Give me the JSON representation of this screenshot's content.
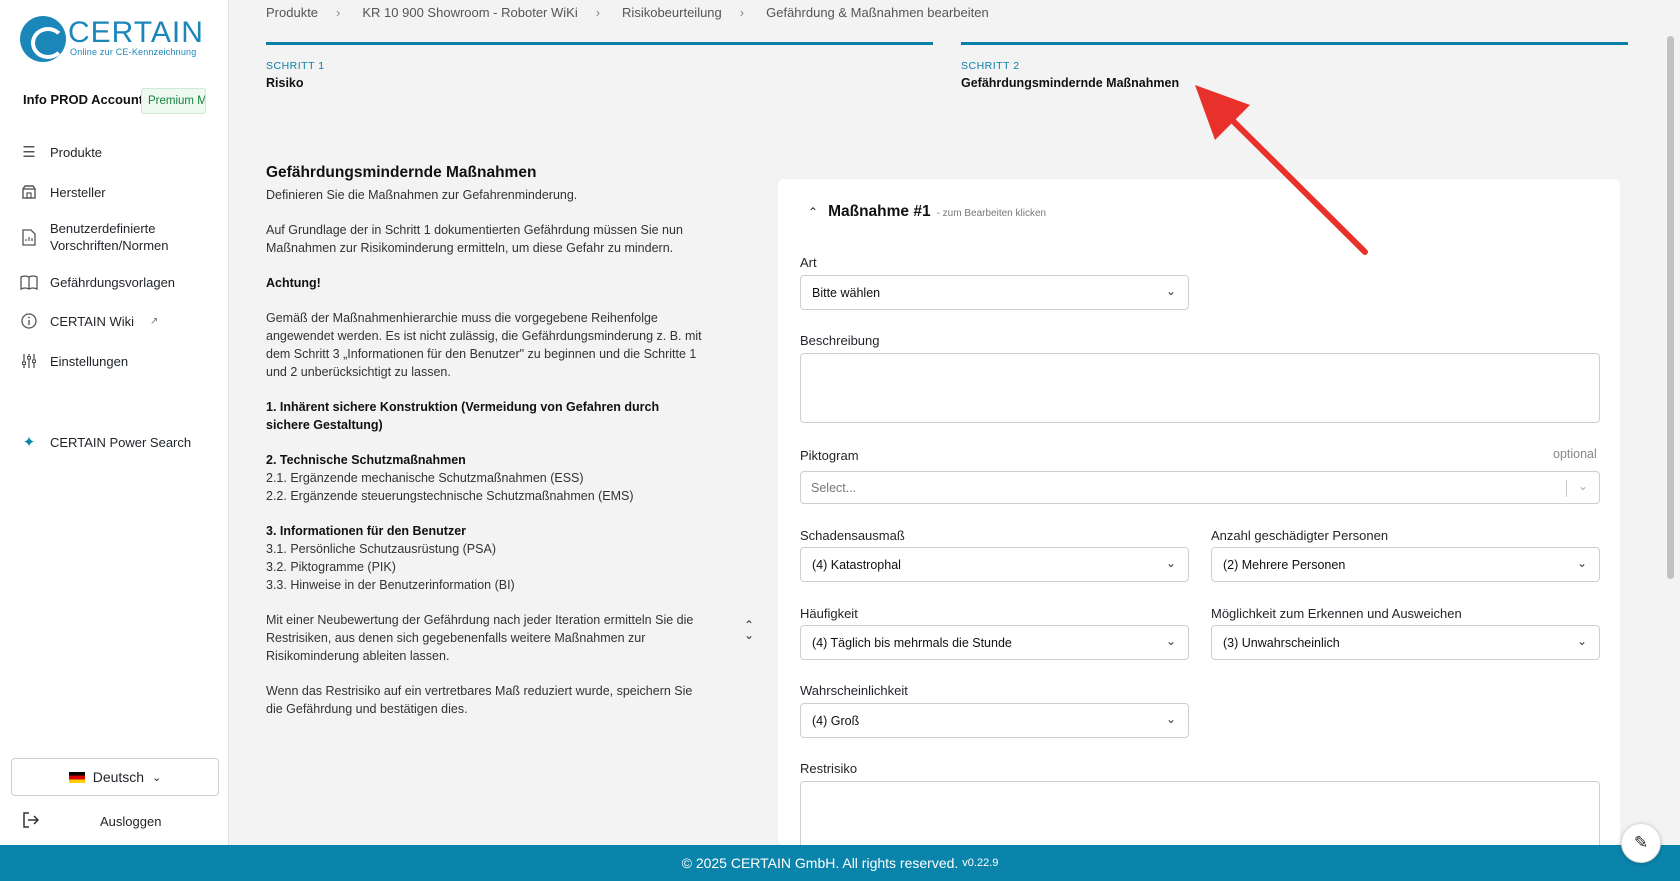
{
  "brand": {
    "name": "CERTAIN",
    "tagline": "Online zur CE-Kennzeichnung"
  },
  "account": {
    "name": "Info PROD Account",
    "plan": "Premium M"
  },
  "nav": [
    {
      "label": "Produkte",
      "icon": "list-icon"
    },
    {
      "label": "Hersteller",
      "icon": "factory-icon"
    },
    {
      "label": "Benutzerdefinierte\nVorschriften/Normen",
      "icon": "document-icon"
    },
    {
      "label": "Gefährdungsvorlagen",
      "icon": "book-icon"
    },
    {
      "label": "CERTAIN Wiki",
      "icon": "info-icon"
    },
    {
      "label": "Einstellungen",
      "icon": "sliders-icon"
    },
    {
      "label": "CERTAIN Power Search",
      "icon": "sparkle-icon"
    }
  ],
  "language": "Deutsch",
  "logout": "Ausloggen",
  "breadcrumbs": [
    "Produkte",
    "KR 10 900 Showroom - Roboter WiKi",
    "Risikobeurteilung",
    "Gefährdung & Maßnahmen bearbeiten"
  ],
  "steps": [
    {
      "num": "SCHRITT 1",
      "title": "Risiko"
    },
    {
      "num": "SCHRITT 2",
      "title": "Gefährdungsmindernde Maßnahmen"
    }
  ],
  "info": {
    "title": "Gefährdungsmindernde Maßnahmen",
    "subtitle": "Definieren Sie die Maßnahmen zur Gefahrenminderung.",
    "p1": "Auf Grundlage der in Schritt 1 dokumentierten Gefährdung müssen Sie nun Maßnahmen zur Risikominderung ermitteln, um diese Gefahr zu mindern.",
    "attention": "Achtung!",
    "p2": "Gemäß der Maßnahmenhierarchie muss die vorgegebene Reihenfolge angewendet werden. Es ist nicht zulässig, die Gefährdungsminderung z. B. mit dem Schritt 3 „Informationen für den Benutzer\" zu beginnen und die Schritte 1 und 2 unberücksichtigt zu lassen.",
    "h1": "1. Inhärent sichere Konstruktion (Vermeidung von Gefahren durch sichere Gestaltung)",
    "h2": "2. Technische Schutzmaßnahmen",
    "h2a": "2.1. Ergänzende mechanische Schutzmaßnahmen (ESS)",
    "h2b": "2.2. Ergänzende steuerungstechnische Schutzmaßnahmen (EMS)",
    "h3": "3. Informationen für den Benutzer",
    "h3a": "3.1. Persönliche Schutzausrüstung (PSA)",
    "h3b": "3.2. Piktogramme (PIK)",
    "h3c": "3.3. Hinweise in der Benutzerinformation (BI)",
    "p3": "Mit einer Neubewertung der Gefährdung nach jeder Iteration ermitteln Sie die Restrisiken, aus denen sich gegebenenfalls weitere Maßnahmen zur Risikominderung ableiten lassen.",
    "p4": "Wenn das Restrisiko auf ein vertretbares Maß reduziert wurde, speichern Sie die Gefährdung und bestätigen dies."
  },
  "form": {
    "measure_title": "Maßnahme #1",
    "measure_hint": "- zum Bearbeiten klicken",
    "art_label": "Art",
    "art_value": "Bitte wählen",
    "beschreibung_label": "Beschreibung",
    "piktogram_label": "Piktogram",
    "optional": "optional",
    "piktogram_placeholder": "Select...",
    "schaden_label": "Schadensausmaß",
    "schaden_value": "(4) Katastrophal",
    "anzahl_label": "Anzahl geschädigter Personen",
    "anzahl_value": "(2) Mehrere Personen",
    "haeufigkeit_label": "Häufigkeit",
    "haeufigkeit_value": "(4) Täglich bis mehrmals die Stunde",
    "moeglichkeit_label": "Möglichkeit zum Erkennen und Ausweichen",
    "moeglichkeit_value": "(3) Unwahrscheinlich",
    "wahrscheinlichkeit_label": "Wahrscheinlichkeit",
    "wahrscheinlichkeit_value": "(4) Groß",
    "restrisiko_label": "Restrisiko"
  },
  "footer": {
    "text": "© 2025 CERTAIN GmbH. All rights reserved.",
    "version": "v0.22.9"
  },
  "colors": {
    "accent": "#0a84aa",
    "arrow": "#e8312a",
    "premium": "#15803d"
  }
}
